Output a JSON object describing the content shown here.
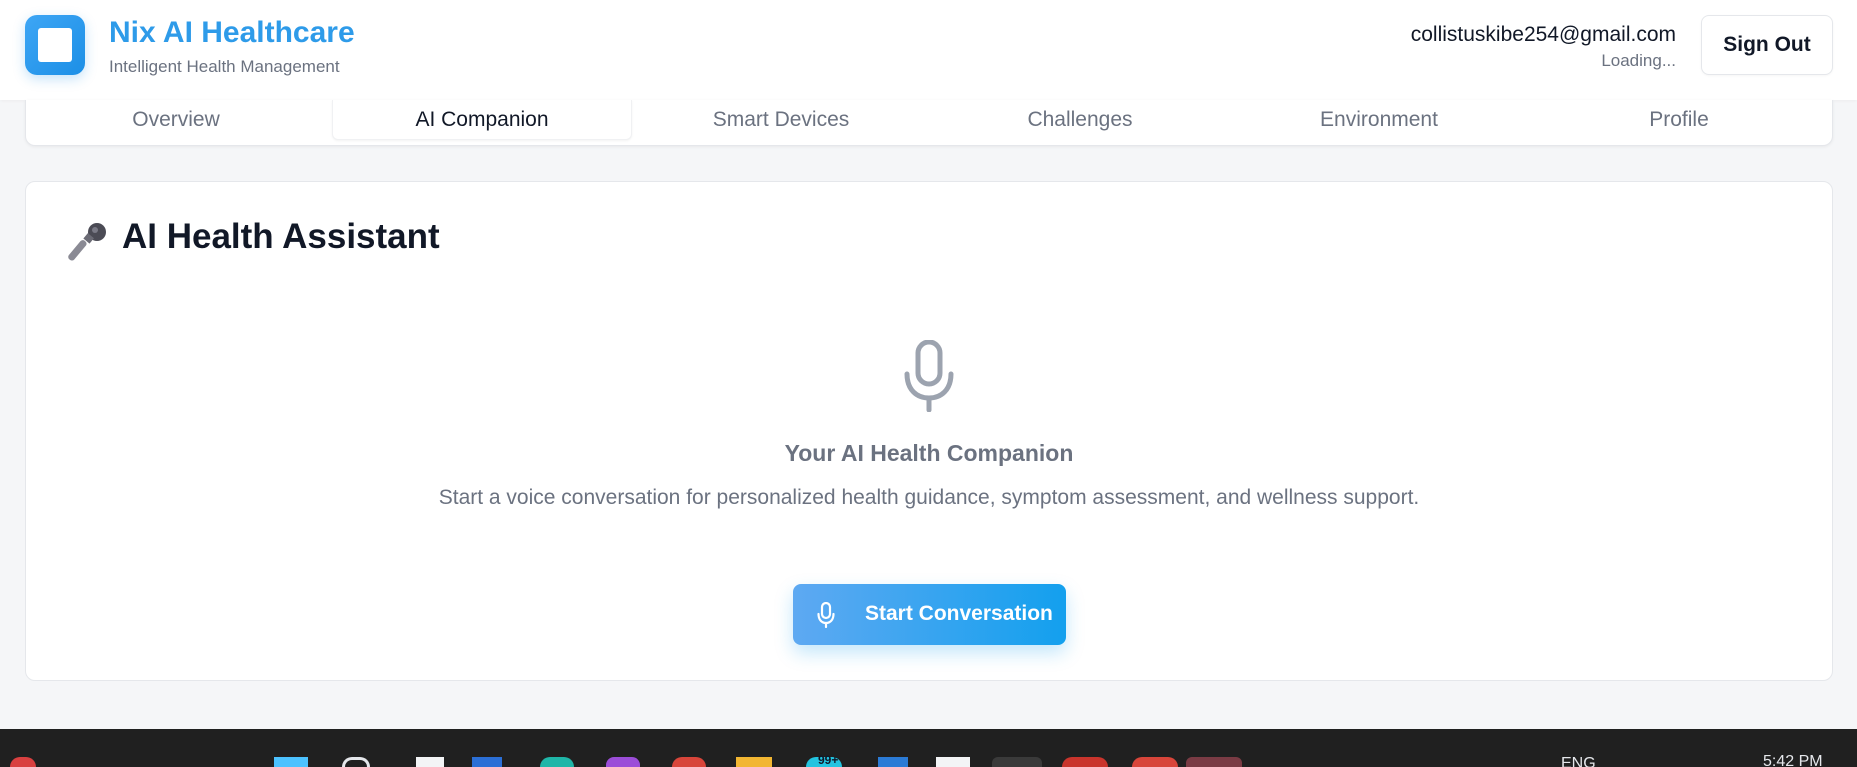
{
  "header": {
    "app_title": "Nix AI Healthcare",
    "app_subtitle": "Intelligent Health Management",
    "user_email": "collistuskibe254@gmail.com",
    "user_status": "Loading...",
    "sign_out_label": "Sign Out"
  },
  "tabs": [
    {
      "label": "Overview",
      "active": false
    },
    {
      "label": "AI Companion",
      "active": true
    },
    {
      "label": "Smart Devices",
      "active": false
    },
    {
      "label": "Challenges",
      "active": false
    },
    {
      "label": "Environment",
      "active": false
    },
    {
      "label": "Profile",
      "active": false
    }
  ],
  "assistant": {
    "title": "AI Health Assistant",
    "title_icon": "microphone-emoji-icon",
    "hero_icon": "microphone-icon",
    "companion_title": "Your AI Health Companion",
    "companion_description": "Start a voice conversation for personalized health guidance, symptom assessment, and wellness support.",
    "start_button_label": "Start Conversation"
  },
  "taskbar": {
    "language": "ENG",
    "time": "5:42 PM",
    "badge_count": "99+"
  },
  "colors": {
    "brand": "#2e9be9",
    "button_gradient_start": "#5ea9f2",
    "button_gradient_end": "#13a0ee",
    "muted_text": "#6b7280",
    "background": "#f5f6f8"
  }
}
